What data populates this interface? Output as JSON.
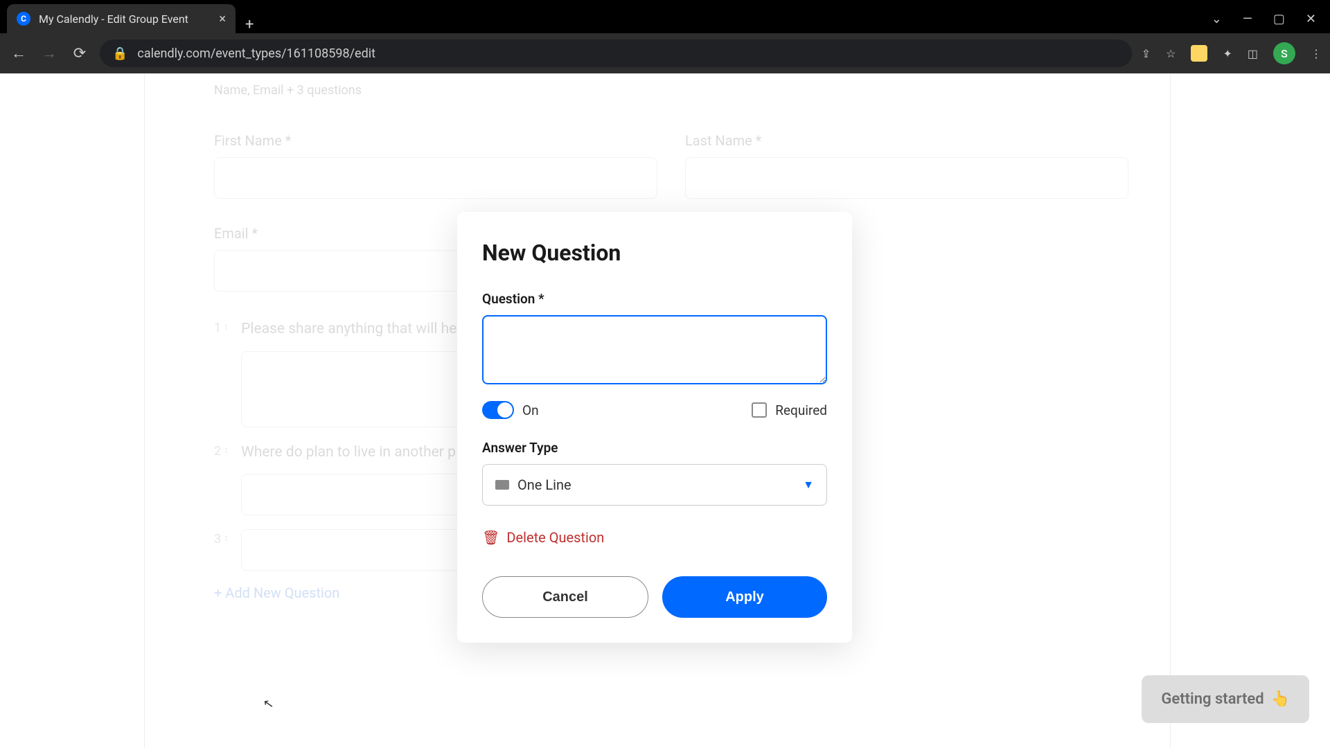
{
  "browser": {
    "tab_title": "My Calendly - Edit Group Event",
    "url": "calendly.com/event_types/161108598/edit",
    "avatar_letter": "S"
  },
  "background_form": {
    "subtitle": "Name, Email + 3 questions",
    "first_name_label": "First Name *",
    "last_name_label": "Last Name *",
    "email_label": "Email *",
    "questions": [
      {
        "num": "1",
        "text": "Please share anything that will help prepare for our meeting."
      },
      {
        "num": "2",
        "text": "Where do plan to live in another p"
      },
      {
        "num": "3",
        "text": ""
      }
    ],
    "add_question": "+  Add New Question"
  },
  "modal": {
    "title": "New Question",
    "question_label": "Question *",
    "question_value": "",
    "toggle_label": "On",
    "required_label": "Required",
    "answer_type_label": "Answer Type",
    "answer_type_value": "One Line",
    "delete_label": "Delete Question",
    "cancel_label": "Cancel",
    "apply_label": "Apply"
  },
  "widget": {
    "getting_started": "Getting started"
  }
}
